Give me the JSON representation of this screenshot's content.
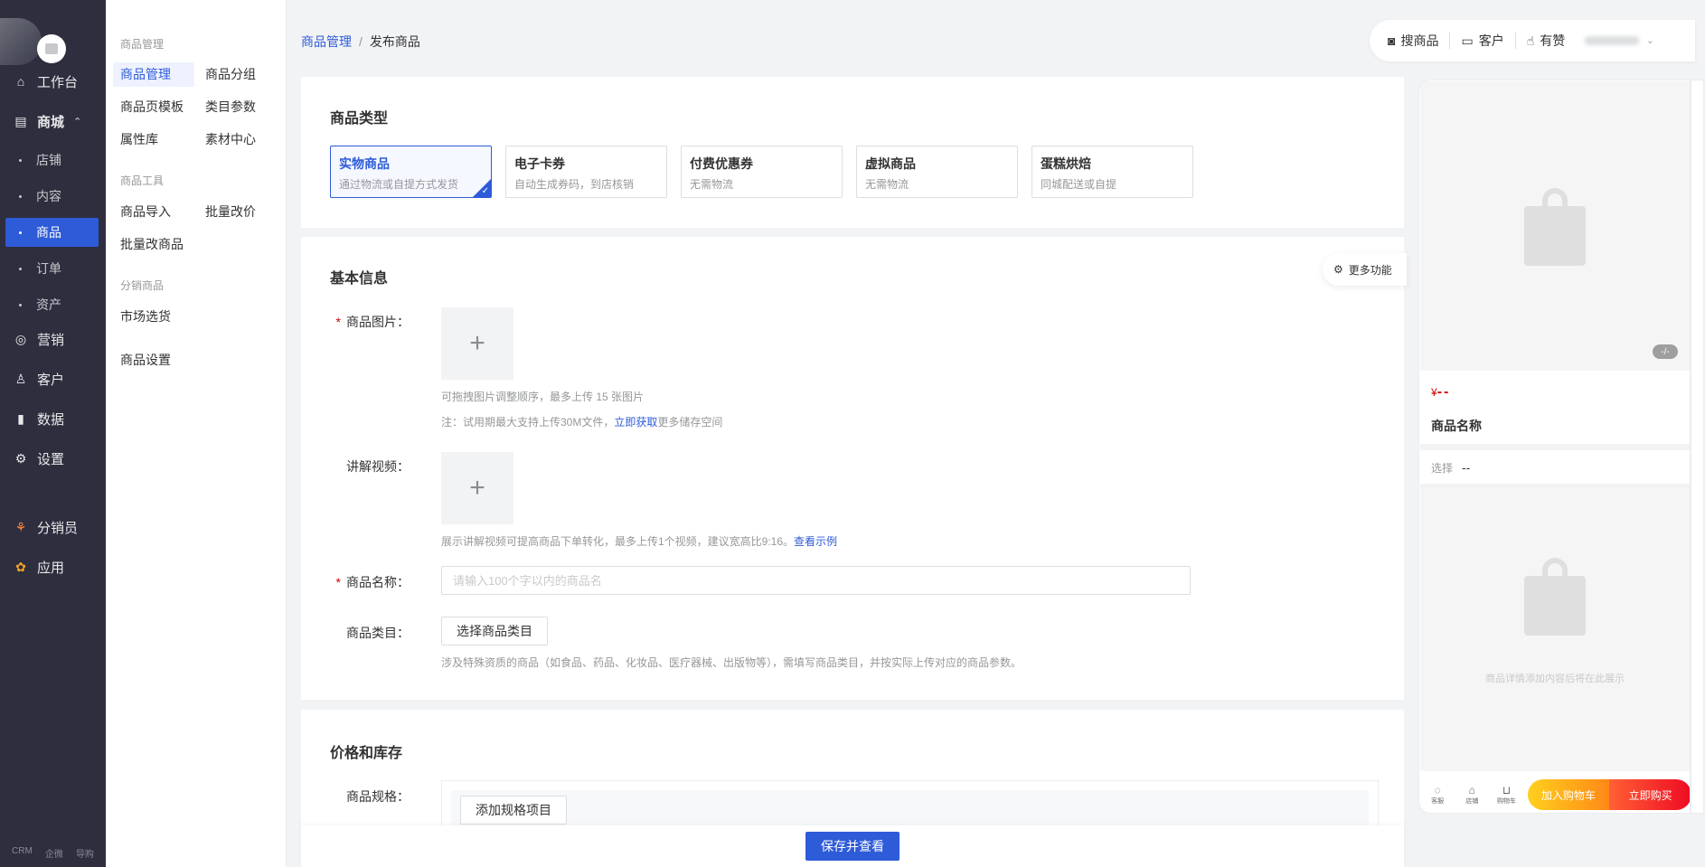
{
  "left_nav": {
    "items": [
      {
        "label": "工作台",
        "icon": "workbench-icon"
      },
      {
        "label": "商城",
        "icon": "store-icon"
      },
      {
        "label": "营销",
        "icon": "marketing-icon"
      },
      {
        "label": "客户",
        "icon": "customer-icon"
      },
      {
        "label": "数据",
        "icon": "data-icon"
      },
      {
        "label": "设置",
        "icon": "settings-icon"
      },
      {
        "label": "分销员",
        "icon": "distributor-icon"
      },
      {
        "label": "应用",
        "icon": "apps-icon"
      }
    ],
    "sub_items": [
      "店铺",
      "内容",
      "商品",
      "订单",
      "资产"
    ],
    "active_sub": "商品",
    "footer": [
      "CRM",
      "企微",
      "导购"
    ]
  },
  "second_nav": {
    "group1": "商品管理",
    "group1_items": [
      "商品管理",
      "商品分组",
      "商品页模板",
      "类目参数",
      "属性库",
      "素材中心"
    ],
    "group2": "商品工具",
    "group2_items": [
      "商品导入",
      "批量改价",
      "批量改商品"
    ],
    "group3": "分销商品",
    "group3_items": [
      "市场选货"
    ],
    "settings": "商品设置"
  },
  "breadcrumb": {
    "parent": "商品管理",
    "sep": "/",
    "current": "发布商品"
  },
  "topbar": {
    "search": "搜商品",
    "customer": "客户",
    "youzan": "有赞"
  },
  "type_section": {
    "title": "商品类型",
    "types": [
      {
        "title": "实物商品",
        "desc": "通过物流或自提方式发货",
        "selected": true
      },
      {
        "title": "电子卡券",
        "desc": "自动生成券码，到店核销"
      },
      {
        "title": "付费优惠券",
        "desc": "无需物流"
      },
      {
        "title": "虚拟商品",
        "desc": "无需物流"
      },
      {
        "title": "蛋糕烘焙",
        "desc": "同城配送或自提"
      }
    ]
  },
  "basic_section": {
    "title": "基本信息",
    "more_functions": "更多功能",
    "image_label": "商品图片：",
    "image_hint1": "可拖拽图片调整顺序，最多上传 15 张图片",
    "image_hint2_pre": "注：试用期最大支持上传30M文件，",
    "image_hint2_link": "立即获取",
    "image_hint2_post": "更多储存空间",
    "video_label": "讲解视频：",
    "video_hint_pre": "展示讲解视频可提高商品下单转化，最多上传1个视频，建议宽高比9:16。",
    "video_hint_link": "查看示例",
    "name_label": "商品名称：",
    "name_placeholder": "请输入100个字以内的商品名",
    "category_label": "商品类目：",
    "category_button": "选择商品类目",
    "category_hint": "涉及特殊资质的商品（如食品、药品、化妆品、医疗器械、出版物等），需填写商品类目，并按实际上传对应的商品参数。",
    "upload_plus": "+"
  },
  "price_section": {
    "title": "价格和库存",
    "spec_label": "商品规格：",
    "add_spec_button": "添加规格项目"
  },
  "footer": {
    "save_button": "保存并查看"
  },
  "preview": {
    "image_count": "-/-",
    "price_symbol": "¥",
    "price_value": "--",
    "product_name": "商品名称",
    "choose_label": "选择",
    "choose_value": "--",
    "detail_placeholder": "商品详情添加内容后将在此展示",
    "actions": [
      {
        "label": "客服",
        "icon": "chat-icon"
      },
      {
        "label": "店铺",
        "icon": "shop-icon"
      },
      {
        "label": "购物车",
        "icon": "cart-icon"
      }
    ],
    "add_cart": "加入购物车",
    "buy_now": "立即购买"
  },
  "colors": {
    "primary": "#2e5bd8",
    "sidebar": "#2e2e3f",
    "danger": "#d40000"
  }
}
